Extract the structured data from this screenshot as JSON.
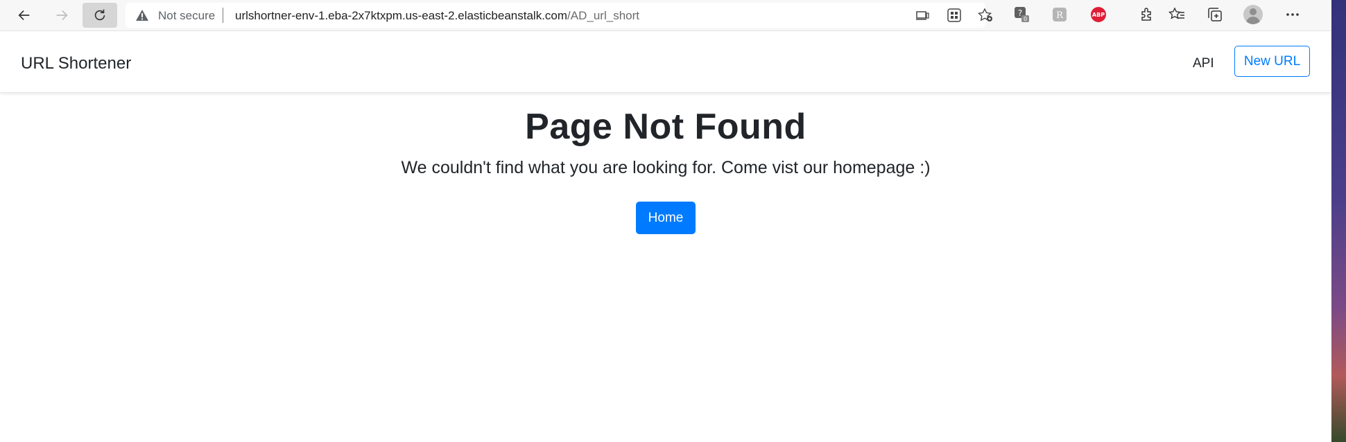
{
  "browser": {
    "security_label": "Not secure",
    "url_host": "urlshortner-env-1.eba-2x7ktxpm.us-east-2.elasticbeanstalk.com",
    "url_path": "/AD_url_short",
    "badge_count": "0",
    "abp_label": "ABP"
  },
  "navbar": {
    "brand": "URL Shortener",
    "api_link": "API",
    "new_url_button": "New URL"
  },
  "main": {
    "title": "Page Not Found",
    "message": "We couldn't find what you are looking for. Come vist our homepage :)",
    "home_button": "Home"
  },
  "colors": {
    "primary": "#007bff",
    "text": "#212529"
  }
}
